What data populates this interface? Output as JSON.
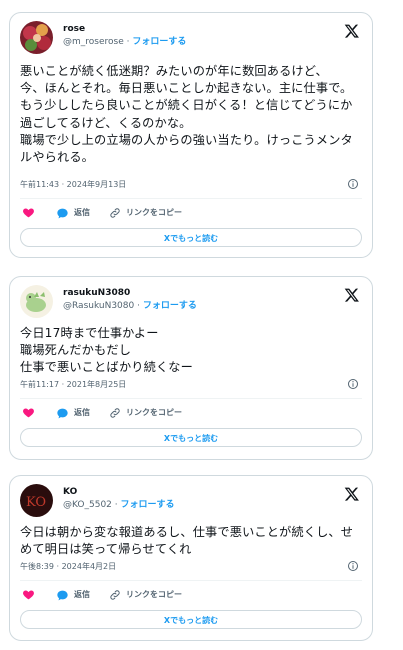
{
  "tweets": [
    {
      "display_name": "rose",
      "handle": "@m_roserose",
      "separator": "·",
      "follow_label": "フォローする",
      "text": "悪いことが続く低迷期？みたいのが年に数回あるけど、\n今、ほんとそれ。毎日悪いことしか起きない。主に仕事で。\nもう少ししたら良いことが続く日がくる！と信じてどうにか過ごしてるけど、くるのかな。\n職場で少し上の立場の人からの強い当たり。けっこうメンタルやられる。",
      "timestamp": "午前11:43 · 2024年9月13日",
      "reply_label": "返信",
      "copy_label": "リンクをコピー",
      "read_more": "Xでもっと読む",
      "avatar_icon": "rose-photo-avatar"
    },
    {
      "display_name": "rasukuN3080",
      "handle": "@RasukuN3080",
      "separator": "·",
      "follow_label": "フォローする",
      "text": "今日17時まで仕事かよー\n職場死んだかもだし\n仕事で悪いことばかり続くなー",
      "timestamp": "午前11:17 · 2021年8月25日",
      "reply_label": "返信",
      "copy_label": "リンクをコピー",
      "read_more": "Xでもっと読む",
      "avatar_icon": "green-creature-avatar"
    },
    {
      "display_name": "KO",
      "handle": "@KO_5502",
      "separator": "·",
      "follow_label": "フォローする",
      "text": "今日は朝から変な報道あるし、仕事で悪いことが続くし、せめて明日は笑って帰らせてくれ",
      "timestamp": "午後8:39 · 2024年4月2日",
      "reply_label": "返信",
      "copy_label": "リンクをコピー",
      "read_more": "Xでもっと読む",
      "avatar_icon": "dark-red-ko-avatar"
    }
  ],
  "colors": {
    "accent": "#1d9bf0",
    "like": "#f91880",
    "border": "#cfd9de",
    "muted": "#536471"
  }
}
